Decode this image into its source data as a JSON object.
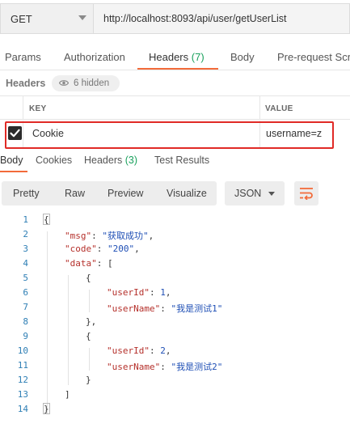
{
  "request": {
    "method": "GET",
    "url": "http://localhost:8093/api/user/getUserList"
  },
  "request_tabs": [
    {
      "label": "Params",
      "count": ""
    },
    {
      "label": "Authorization",
      "count": ""
    },
    {
      "label": "Headers",
      "count": "(7)"
    },
    {
      "label": "Body",
      "count": ""
    },
    {
      "label": "Pre-request Scri",
      "count": ""
    }
  ],
  "headers_section": {
    "title": "Headers",
    "hidden_label": "6 hidden"
  },
  "headers_table": {
    "col_key": "KEY",
    "col_value": "VALUE",
    "rows": [
      {
        "checked": true,
        "key": "Cookie",
        "value": "username=z"
      }
    ]
  },
  "response_tabs": [
    {
      "label": "Body",
      "count": ""
    },
    {
      "label": "Cookies",
      "count": ""
    },
    {
      "label": "Headers",
      "count": "(3)"
    },
    {
      "label": "Test Results",
      "count": ""
    }
  ],
  "response_toolbar": {
    "formats": [
      "Pretty",
      "Raw",
      "Preview",
      "Visualize"
    ],
    "language": "JSON"
  },
  "code_lines": [
    {
      "num": "1",
      "text": "{"
    },
    {
      "num": "2",
      "key": "\"msg\"",
      "value": "\"获取成功\"",
      "tail": ","
    },
    {
      "num": "3",
      "key": "\"code\"",
      "value": "\"200\"",
      "tail": ","
    },
    {
      "num": "4",
      "key": "\"data\"",
      "value": "",
      "tail": "["
    },
    {
      "num": "5",
      "text": "{"
    },
    {
      "num": "6",
      "key": "\"userId\"",
      "value": "1",
      "tail": ","
    },
    {
      "num": "7",
      "key": "\"userName\"",
      "value": "\"我是测试1\"",
      "tail": ""
    },
    {
      "num": "8",
      "text": "},"
    },
    {
      "num": "9",
      "text": "{"
    },
    {
      "num": "10",
      "key": "\"userId\"",
      "value": "2",
      "tail": ","
    },
    {
      "num": "11",
      "key": "\"userName\"",
      "value": "\"我是测试2\"",
      "tail": ""
    },
    {
      "num": "12",
      "text": "}"
    },
    {
      "num": "13",
      "text": "]"
    },
    {
      "num": "14",
      "text": "}"
    }
  ],
  "colors": {
    "accent": "#f26b3a",
    "count_green": "#1aa15d",
    "highlight_red": "#e02a26",
    "json_key": "#b5302b",
    "json_value": "#1f4fb5",
    "line_number": "#2f7fb5"
  }
}
